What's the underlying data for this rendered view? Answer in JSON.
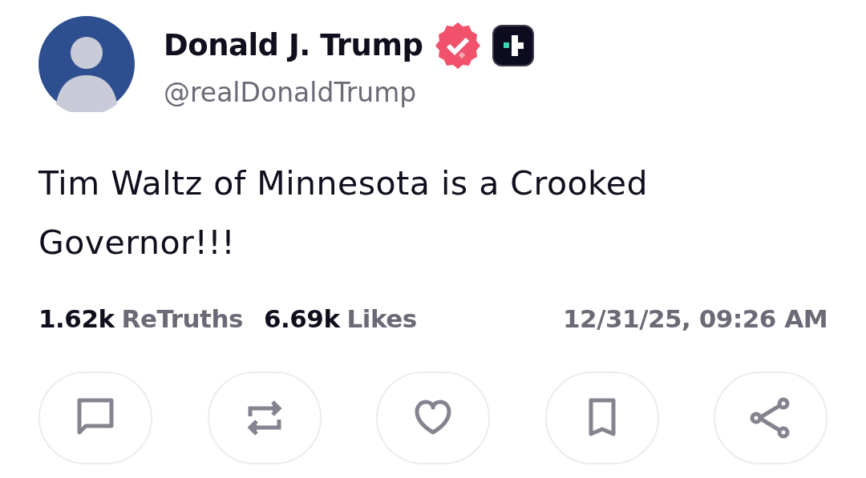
{
  "post": {
    "author": {
      "name": "Donald J. Trump",
      "handle": "@realDonaldTrump",
      "verified": true
    },
    "text": "Tim Waltz of Minnesota is a Crooked Governor!!!",
    "stats": [
      {
        "count": "1.62k",
        "label": "ReTruths"
      },
      {
        "count": "6.69k",
        "label": "Likes"
      }
    ],
    "timestamp": "12/31/25, 09:26 AM",
    "actions": [
      {
        "kind": "reply"
      },
      {
        "kind": "retruth"
      },
      {
        "kind": "like"
      },
      {
        "kind": "bookmark"
      },
      {
        "kind": "share"
      }
    ]
  }
}
